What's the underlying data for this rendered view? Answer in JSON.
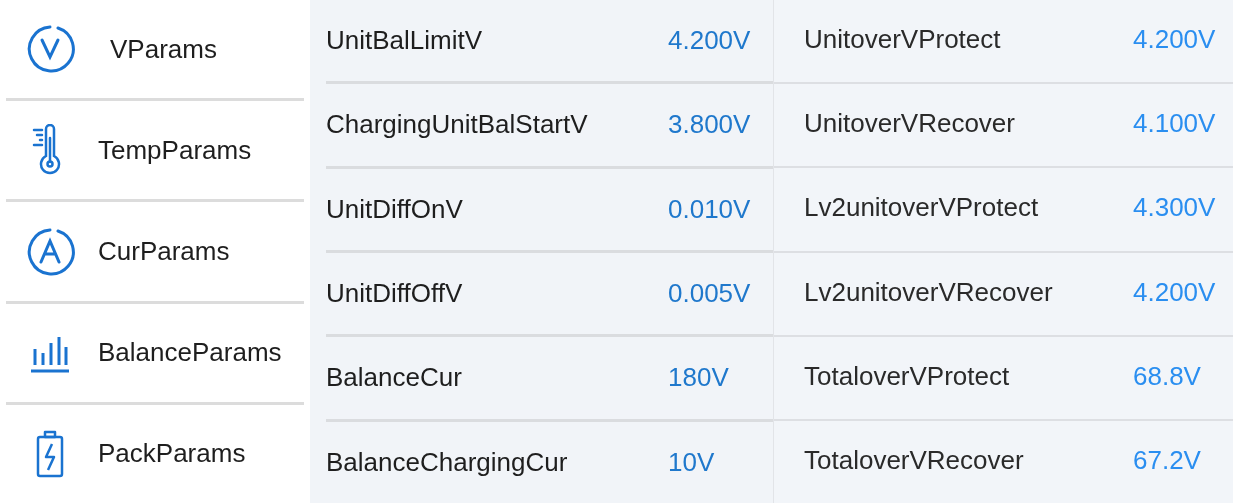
{
  "sidebar": {
    "items": [
      {
        "kind": "volt",
        "label": "VParams"
      },
      {
        "kind": "temp",
        "label": "TempParams"
      },
      {
        "kind": "amp",
        "label": "CurParams"
      },
      {
        "kind": "bars",
        "label": "BalanceParams"
      },
      {
        "kind": "battery",
        "label": "PackParams"
      }
    ]
  },
  "columns": [
    {
      "rows": [
        {
          "label": "UnitBalLimitV",
          "value": "4.200V"
        },
        {
          "label": "ChargingUnitBalStartV",
          "value": "3.800V"
        },
        {
          "label": "UnitDiffOnV",
          "value": "0.010V"
        },
        {
          "label": "UnitDiffOffV",
          "value": "0.005V"
        },
        {
          "label": "BalanceCur",
          "value": "180V"
        },
        {
          "label": "BalanceChargingCur",
          "value": "10V"
        }
      ]
    },
    {
      "rows": [
        {
          "label": "UnitoverVProtect",
          "value": "4.200V"
        },
        {
          "label": "UnitoverVRecover",
          "value": "4.100V"
        },
        {
          "label": "Lv2unitoverVProtect",
          "value": "4.300V"
        },
        {
          "label": "Lv2unitoverVRecover",
          "value": "4.200V"
        },
        {
          "label": "TotaloverVProtect",
          "value": "68.8V"
        },
        {
          "label": "TotaloverVRecover",
          "value": "67.2V"
        }
      ]
    }
  ]
}
